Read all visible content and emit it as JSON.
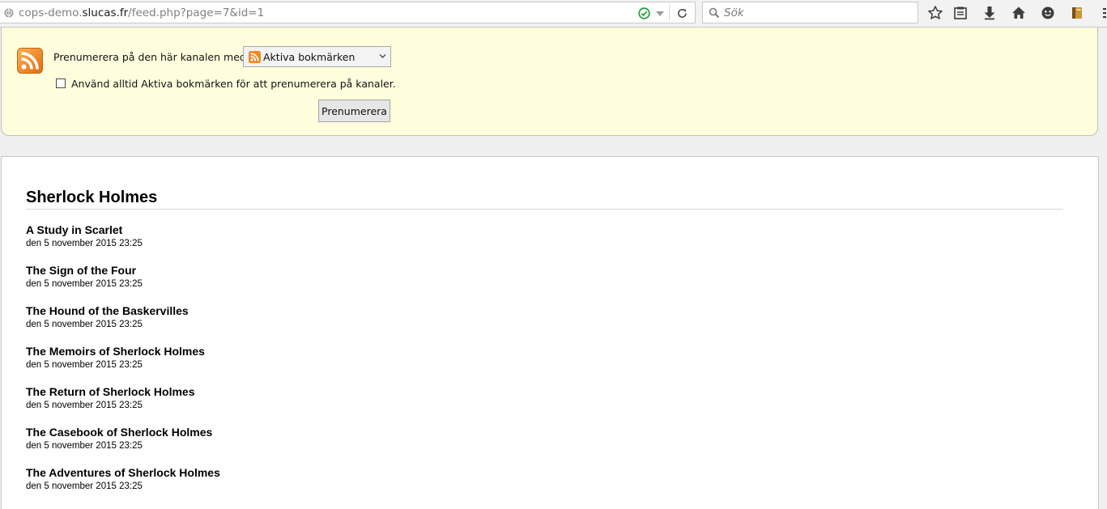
{
  "browser": {
    "url_prefix": "cops-demo.",
    "url_domain": "slucas.fr",
    "url_path": "/feed.php?page=7&id=1",
    "search_placeholder": "Sök",
    "icons": [
      "globe-icon",
      "verified-check-icon",
      "dropdown-arrow-icon",
      "reload-icon",
      "search-icon",
      "bookmark-star-icon",
      "reading-list-icon",
      "download-icon",
      "home-icon",
      "smiley-icon",
      "extension-icon",
      "menu-icon"
    ]
  },
  "subscribe": {
    "label": "Prenumerera på den här kanalen med",
    "reader_selected": "Aktiva bokmärken",
    "always_use_label": "Använd alltid Aktiva bokmärken för att prenumerera på kanaler.",
    "always_use_checked": false,
    "button_label": "Prenumerera"
  },
  "feed": {
    "title": "Sherlock Holmes",
    "entries": [
      {
        "title": "A Study in Scarlet",
        "date": "den 5 november 2015 23:25"
      },
      {
        "title": "The Sign of the Four",
        "date": "den 5 november 2015 23:25"
      },
      {
        "title": "The Hound of the Baskervilles",
        "date": "den 5 november 2015 23:25"
      },
      {
        "title": "The Memoirs of Sherlock Holmes",
        "date": "den 5 november 2015 23:25"
      },
      {
        "title": "The Return of Sherlock Holmes",
        "date": "den 5 november 2015 23:25"
      },
      {
        "title": "The Casebook of Sherlock Holmes",
        "date": "den 5 november 2015 23:25"
      },
      {
        "title": "The Adventures of Sherlock Holmes",
        "date": "den 5 november 2015 23:25"
      }
    ]
  },
  "colors": {
    "subscribe_bg": "#ffffde",
    "feed_icon_orange": "#f58a1f",
    "check_green": "#2ea043"
  }
}
